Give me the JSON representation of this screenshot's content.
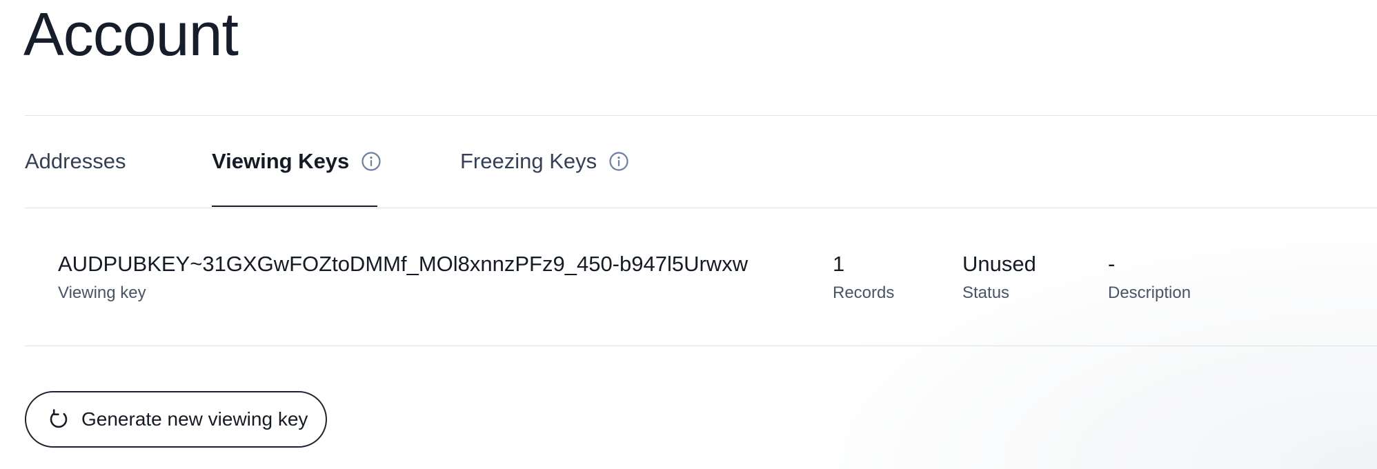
{
  "page": {
    "title": "Account"
  },
  "tabs": [
    {
      "label": "Addresses",
      "active": false,
      "has_info_icon": false
    },
    {
      "label": "Viewing Keys",
      "active": true,
      "has_info_icon": true
    },
    {
      "label": "Freezing Keys",
      "active": false,
      "has_info_icon": true
    }
  ],
  "viewing_key": {
    "key": "AUDPUBKEY~31GXGwFOZtoDMMf_MOl8xnnzPFz9_450-b947l5Urwxw",
    "key_label": "Viewing key",
    "records": "1",
    "records_label": "Records",
    "status": "Unused",
    "status_label": "Status",
    "description": "-",
    "description_label": "Description"
  },
  "actions": {
    "generate_label": "Generate new viewing key",
    "generate_icon": "refresh-icon"
  },
  "colors": {
    "text_primary": "#151b26",
    "text_secondary": "#485469",
    "tab_inactive": "#34405a",
    "icon_accent": "#6b7fa8",
    "divider": "#dfe3e8"
  }
}
